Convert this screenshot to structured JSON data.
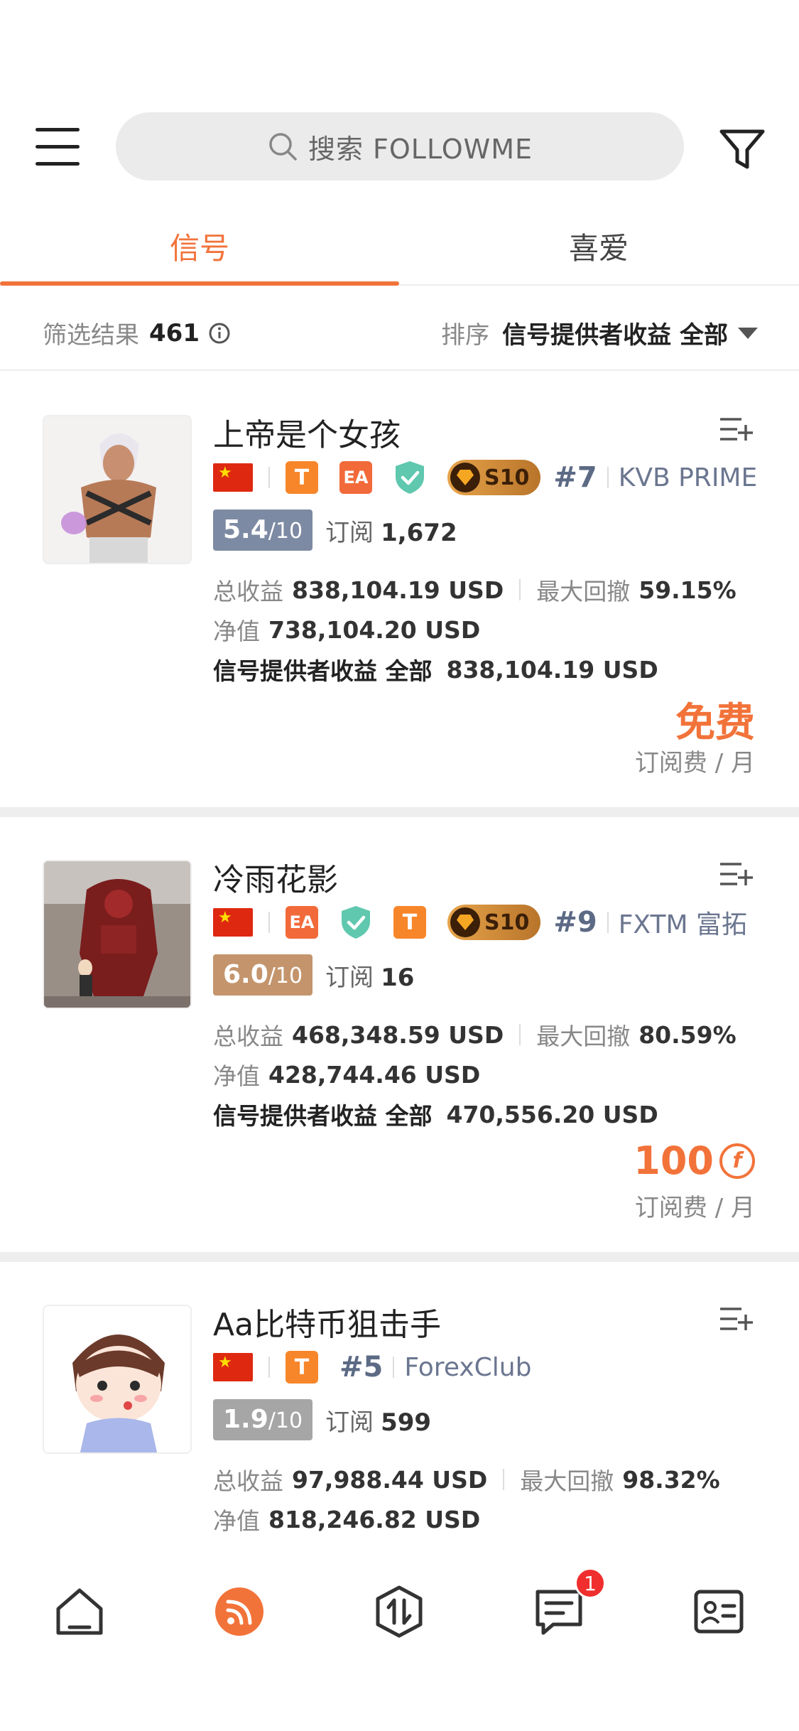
{
  "search": {
    "placeholder": "搜索 FOLLOWME"
  },
  "tabs": [
    {
      "label": "信号",
      "active": true
    },
    {
      "label": "喜爱",
      "active": false
    }
  ],
  "filter_bar": {
    "result_label": "筛选结果",
    "result_count": "461",
    "sort_label": "排序",
    "sort_value": "信号提供者收益 全部"
  },
  "cards": [
    {
      "name": "上帝是个女孩",
      "chips": [
        "T",
        "EA"
      ],
      "tier": "S10",
      "rank": "#7",
      "broker": "KVB PRIME",
      "score": "5.4",
      "score_den": "/10",
      "score_color": "#7d8aa3",
      "subs_label": "订阅",
      "subs": "1,672",
      "total_label": "总收益",
      "total": "838,104.19 USD",
      "drawdown_label": "最大回撤",
      "drawdown": "59.15%",
      "equity_label": "净值",
      "equity": "738,104.20 USD",
      "provider_label": "信号提供者收益 全部",
      "provider": "838,104.19 USD",
      "price": "免费",
      "price_sub": "订阅费 / 月"
    },
    {
      "name": "冷雨花影",
      "chips": [
        "EA",
        "T"
      ],
      "tier": "S10",
      "rank": "#9",
      "broker": "FXTM 富拓",
      "score": "6.0",
      "score_den": "/10",
      "score_color": "#c4956d",
      "subs_label": "订阅",
      "subs": "16",
      "total_label": "总收益",
      "total": "468,348.59 USD",
      "drawdown_label": "最大回撤",
      "drawdown": "80.59%",
      "equity_label": "净值",
      "equity": "428,744.46 USD",
      "provider_label": "信号提供者收益 全部",
      "provider": "470,556.20 USD",
      "price": "100",
      "price_currency_symbol": "f",
      "price_sub": "订阅费 / 月"
    },
    {
      "name": "Aa比特币狙击手",
      "chips": [
        "T"
      ],
      "rank": "#5",
      "broker": "ForexClub",
      "score": "1.9",
      "score_den": "/10",
      "score_color": "#a6a6a6",
      "subs_label": "订阅",
      "subs": "599",
      "total_label": "总收益",
      "total": "97,988.44 USD",
      "drawdown_label": "最大回撤",
      "drawdown": "98.32%",
      "equity_label": "净值",
      "equity": "818,246.82 USD"
    }
  ],
  "bottom_nav": {
    "items": [
      "home-icon",
      "signals-icon",
      "trade-icon",
      "messages-icon",
      "profile-card-icon"
    ],
    "messages_badge": "1"
  },
  "colors": {
    "accent": "#f2733a",
    "rank": "#5c6a85"
  }
}
